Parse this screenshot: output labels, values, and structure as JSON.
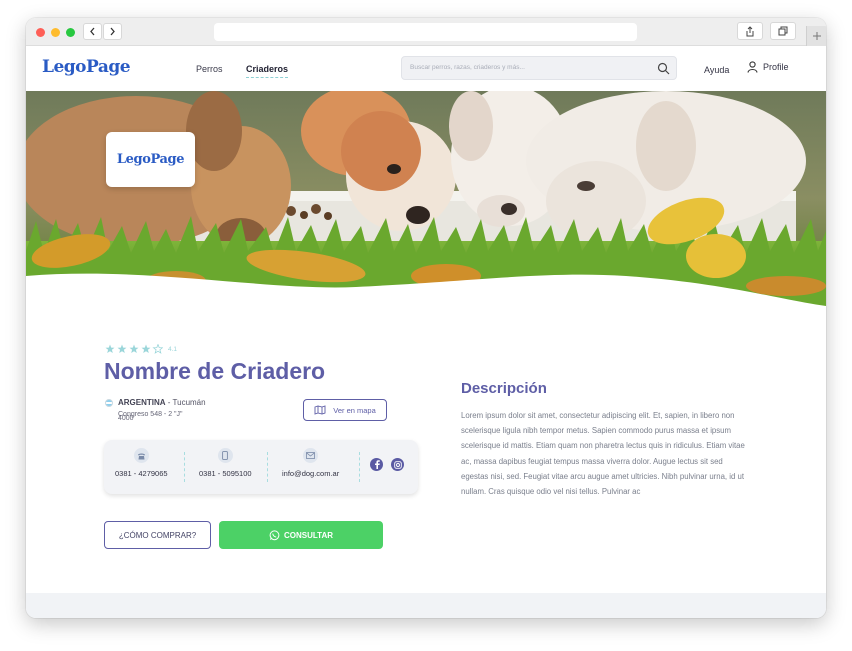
{
  "browser": {
    "url": ""
  },
  "header": {
    "logo": "LegoPage",
    "nav": [
      "Perros",
      "Criaderos"
    ],
    "active_nav": "Criaderos",
    "search_placeholder": "Buscar perros, razas, criaderos y más...",
    "help": "Ayuda",
    "profile": "Profile"
  },
  "hero": {
    "card_logo": "LegoPage"
  },
  "kennel": {
    "rating": "4.1",
    "rating_stars": 4,
    "rating_max": 5,
    "name": "Nombre de Criadero",
    "country": "ARGENTINA",
    "city": " - Tucumán",
    "address": "Congreso 548 - 2 \"J\"",
    "postal_code": "4000",
    "map_button": "Ver en mapa",
    "contact": {
      "phone": "0381 - 4279065",
      "mobile": "0381 - 5095100",
      "email": "info@dog.com.ar"
    },
    "how_to_buy": "¿CÓMO COMPRAR?",
    "consult": "CONSULTAR"
  },
  "description": {
    "title": "Descripción",
    "text": "Lorem ipsum dolor sit amet, consectetur adipiscing elit. Et, sapien, in libero non scelerisque ligula nibh tempor metus. Sapien commodo purus massa et ipsum scelerisque id mattis. Etiam quam non pharetra lectus quis in ridiculus. Etiam vitae ac, massa dapibus feugiat tempus massa viverra dolor. Augue lectus sit sed egestas nisi, sed. Feugiat vitae arcu augue amet ultricies. Nibh pulvinar urna, id ut nullam. Cras quisque odio vel nisi tellus. Pulvinar ac"
  },
  "colors": {
    "brand": "#2a5bc4",
    "primary": "#5e5ea6",
    "accent": "#8fd0d4",
    "whatsapp": "#4cd166"
  }
}
